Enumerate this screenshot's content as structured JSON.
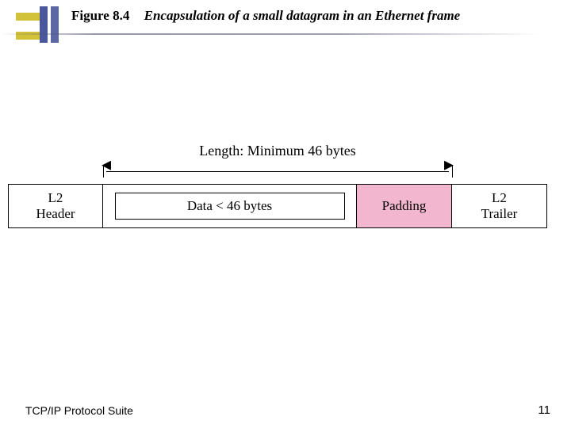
{
  "title": {
    "figure": "Figure 8.4",
    "caption": "Encapsulation of a small datagram in an Ethernet frame"
  },
  "diagram": {
    "span_label": "Length: Minimum 46 bytes",
    "l2_header": "L2\nHeader",
    "data": "Data < 46 bytes",
    "padding": "Padding",
    "l2_trailer": "L2\nTrailer"
  },
  "footer": {
    "left": "TCP/IP Protocol Suite",
    "page": "11"
  }
}
